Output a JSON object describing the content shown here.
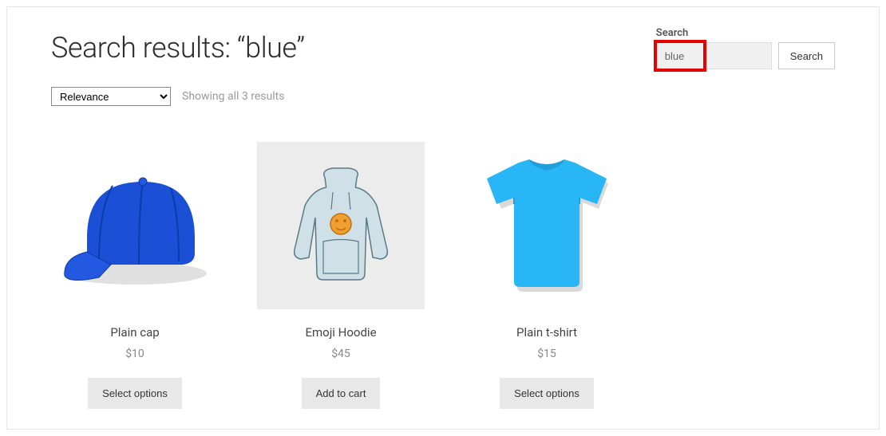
{
  "header": {
    "title": "Search results: “blue”"
  },
  "search_widget": {
    "label": "Search",
    "input_value": "blue",
    "button_label": "Search"
  },
  "controls": {
    "sort_selected": "Relevance",
    "results_text": "Showing all 3 results"
  },
  "products": [
    {
      "title": "Plain cap",
      "price": "$10",
      "button_label": "Select options",
      "image_kind": "cap",
      "bg": "plain"
    },
    {
      "title": "Emoji Hoodie",
      "price": "$45",
      "button_label": "Add to cart",
      "image_kind": "hoodie",
      "bg": "grey"
    },
    {
      "title": "Plain t-shirt",
      "price": "$15",
      "button_label": "Select options",
      "image_kind": "tshirt",
      "bg": "plain"
    }
  ],
  "colors": {
    "highlight_red": "#e60000",
    "cap_blue": "#1a4fd6",
    "hoodie_blue": "#cfe0e6",
    "tshirt_blue": "#29b6f6"
  }
}
